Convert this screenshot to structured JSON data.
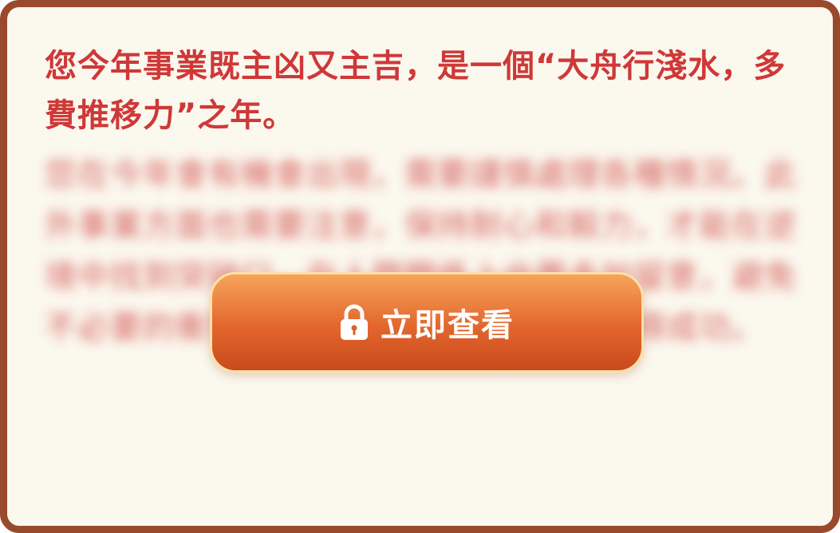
{
  "content": {
    "intro_text": "您今年事業既主凶又主吉，是一個“大舟行淺水，多費推移力”之年。",
    "blurred_text": "您在今年會有機會出現，需要謹慎處理各種情況。此外事業方面也需要注意，保持耐心和毅力，才能在逆境中找到突破口。在人際關係上也要多加留意，避免不必要的衝突與誤會，穩步前進，方能獲得成功。"
  },
  "unlock_button": {
    "label": "立即查看",
    "icon": "lock-icon"
  },
  "colors": {
    "frame": "#9a4a2c",
    "background": "#fbf8ee",
    "text": "#cf3838",
    "button_top": "#f7a45a",
    "button_bottom": "#c94a1e"
  }
}
